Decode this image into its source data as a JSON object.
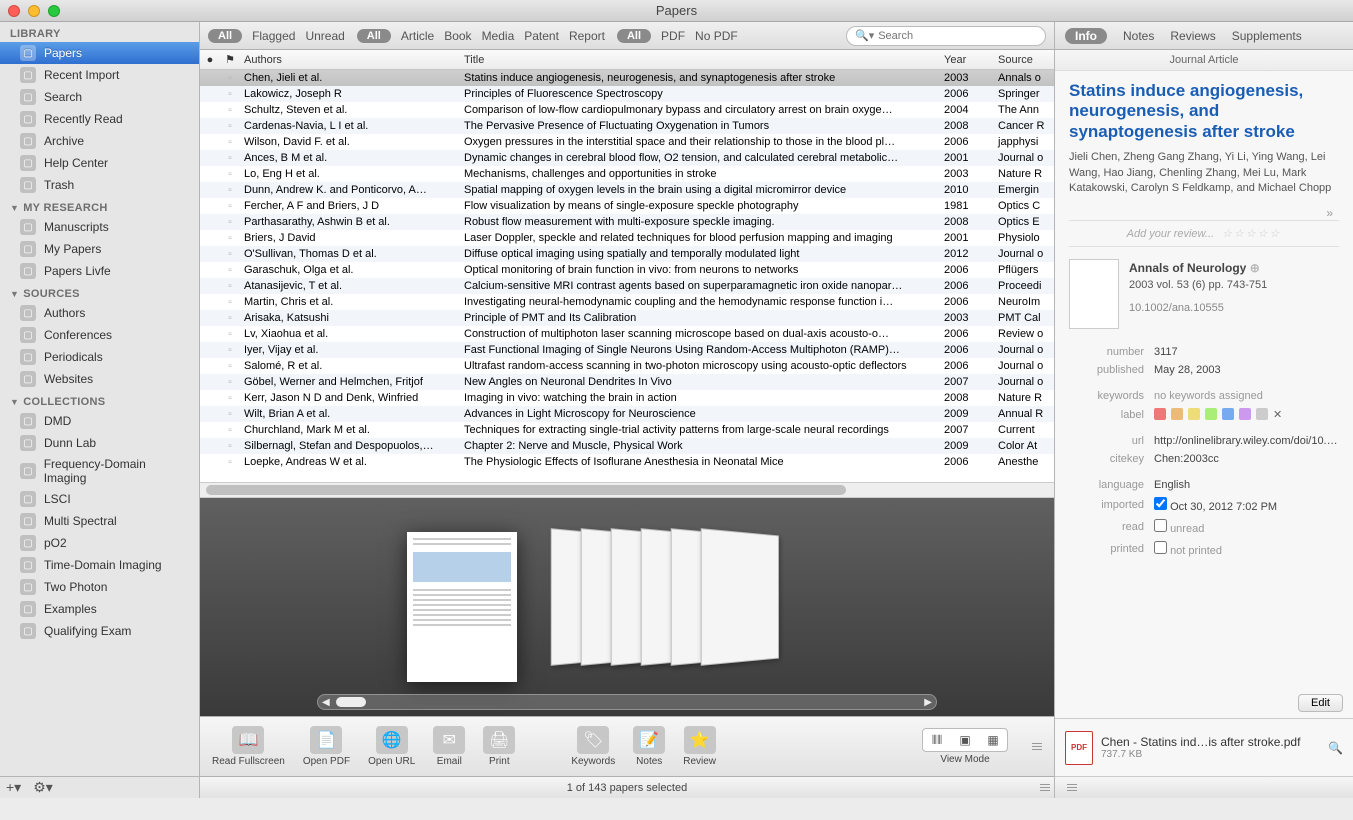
{
  "window": {
    "title": "Papers"
  },
  "sidebar": {
    "sections": [
      {
        "title": "LIBRARY",
        "items": [
          {
            "label": "Papers",
            "selected": true
          },
          {
            "label": "Recent Import"
          },
          {
            "label": "Search"
          },
          {
            "label": "Recently Read"
          },
          {
            "label": "Archive"
          },
          {
            "label": "Help Center"
          },
          {
            "label": "Trash"
          }
        ]
      },
      {
        "title": "MY RESEARCH",
        "items": [
          {
            "label": "Manuscripts"
          },
          {
            "label": "My Papers"
          },
          {
            "label": "Papers Livfe"
          }
        ]
      },
      {
        "title": "SOURCES",
        "items": [
          {
            "label": "Authors"
          },
          {
            "label": "Conferences"
          },
          {
            "label": "Periodicals"
          },
          {
            "label": "Websites"
          }
        ]
      },
      {
        "title": "COLLECTIONS",
        "items": [
          {
            "label": "DMD"
          },
          {
            "label": "Dunn Lab"
          },
          {
            "label": "Frequency-Domain Imaging"
          },
          {
            "label": "LSCI"
          },
          {
            "label": "Multi Spectral"
          },
          {
            "label": "pO2"
          },
          {
            "label": "Time-Domain Imaging"
          },
          {
            "label": "Two Photon"
          },
          {
            "label": "Examples"
          },
          {
            "label": "Qualifying Exam"
          }
        ]
      }
    ]
  },
  "toolbar": {
    "all1": "All",
    "flagged": "Flagged",
    "unread": "Unread",
    "all2": "All",
    "article": "Article",
    "book": "Book",
    "media": "Media",
    "patent": "Patent",
    "report": "Report",
    "all3": "All",
    "pdf": "PDF",
    "nopdf": "No PDF",
    "search_placeholder": "Search"
  },
  "columns": {
    "authors": "Authors",
    "title": "Title",
    "year": "Year",
    "source": "Source"
  },
  "papers": [
    {
      "authors": "Chen, Jieli et al.",
      "title": "Statins induce angiogenesis, neurogenesis, and synaptogenesis after stroke",
      "year": "2003",
      "source": "Annals o",
      "selected": true
    },
    {
      "authors": "Lakowicz, Joseph R",
      "title": "Principles of Fluorescence Spectroscopy",
      "year": "2006",
      "source": "Springer"
    },
    {
      "authors": "Schultz, Steven et al.",
      "title": "Comparison of low-flow cardiopulmonary bypass and circulatory arrest on brain oxyge…",
      "year": "2004",
      "source": "The Ann"
    },
    {
      "authors": "Cardenas-Navia, L I et al.",
      "title": "The Pervasive Presence of Fluctuating Oxygenation in Tumors",
      "year": "2008",
      "source": "Cancer R"
    },
    {
      "authors": "Wilson, David F. et al.",
      "title": "Oxygen pressures in the interstitial space and their relationship to those in the blood pl…",
      "year": "2006",
      "source": "japphysi"
    },
    {
      "authors": "Ances, B M et al.",
      "title": "Dynamic changes in cerebral blood flow, O2 tension, and calculated cerebral metabolic…",
      "year": "2001",
      "source": "Journal o"
    },
    {
      "authors": "Lo, Eng H et al.",
      "title": "Mechanisms, challenges and opportunities in stroke",
      "year": "2003",
      "source": "Nature R"
    },
    {
      "authors": "Dunn, Andrew K. and Ponticorvo, A…",
      "title": "Spatial mapping of oxygen levels in the brain using a digital micromirror device",
      "year": "2010",
      "source": "Emergin"
    },
    {
      "authors": "Fercher, A F and Briers, J D",
      "title": "Flow visualization by means of single-exposure speckle photography",
      "year": "1981",
      "source": "Optics C"
    },
    {
      "authors": "Parthasarathy, Ashwin B et al.",
      "title": "Robust flow measurement with multi-exposure speckle imaging.",
      "year": "2008",
      "source": "Optics E"
    },
    {
      "authors": "Briers, J David",
      "title": "Laser Doppler, speckle and related techniques for blood perfusion mapping and imaging",
      "year": "2001",
      "source": "Physiolo"
    },
    {
      "authors": "O'Sullivan, Thomas D et al.",
      "title": "Diffuse optical imaging using spatially and temporally modulated light",
      "year": "2012",
      "source": "Journal o"
    },
    {
      "authors": "Garaschuk, Olga et al.",
      "title": "Optical monitoring of brain function in vivo: from neurons to networks",
      "year": "2006",
      "source": "Pflügers"
    },
    {
      "authors": "Atanasijevic, T et al.",
      "title": "Calcium-sensitive MRI contrast agents based on superparamagnetic iron oxide nanopar…",
      "year": "2006",
      "source": "Proceedi"
    },
    {
      "authors": "Martin, Chris et al.",
      "title": "Investigating neural-hemodynamic coupling and the hemodynamic response function i…",
      "year": "2006",
      "source": "NeuroIm"
    },
    {
      "authors": "Arisaka, Katsushi",
      "title": "Principle of PMT and Its Calibration",
      "year": "2003",
      "source": "PMT Cal"
    },
    {
      "authors": "Lv, Xiaohua et al.",
      "title": "Construction of multiphoton laser scanning microscope based on dual-axis acousto-o…",
      "year": "2006",
      "source": "Review o"
    },
    {
      "authors": "Iyer, Vijay et al.",
      "title": "Fast Functional Imaging of Single Neurons Using Random-Access Multiphoton (RAMP)…",
      "year": "2006",
      "source": "Journal o"
    },
    {
      "authors": "Salomé, R et al.",
      "title": "Ultrafast random-access scanning in two-photon microscopy using acousto-optic deflectors",
      "year": "2006",
      "source": "Journal o"
    },
    {
      "authors": "Göbel, Werner and Helmchen, Fritjof",
      "title": "New Angles on Neuronal Dendrites In Vivo",
      "year": "2007",
      "source": "Journal o"
    },
    {
      "authors": "Kerr, Jason N D and Denk, Winfried",
      "title": "Imaging in vivo: watching the brain in action",
      "year": "2008",
      "source": "Nature R"
    },
    {
      "authors": "Wilt, Brian A et al.",
      "title": "Advances in Light Microscopy for Neuroscience",
      "year": "2009",
      "source": "Annual R"
    },
    {
      "authors": "Churchland, Mark M et al.",
      "title": "Techniques for extracting single-trial activity patterns from large-scale neural recordings",
      "year": "2007",
      "source": "Current"
    },
    {
      "authors": "Silbernagl, Stefan and Despopuolos,…",
      "title": "Chapter 2: Nerve and Muscle, Physical Work",
      "year": "2009",
      "source": "Color At"
    },
    {
      "authors": "Loepke, Andreas W et al.",
      "title": "The Physiologic Effects of Isoflurane Anesthesia in Neonatal Mice",
      "year": "2006",
      "source": "Anesthe"
    }
  ],
  "bottombar": {
    "items": [
      {
        "label": "Read Fullscreen"
      },
      {
        "label": "Open PDF"
      },
      {
        "label": "Open URL"
      },
      {
        "label": "Email"
      },
      {
        "label": "Print"
      },
      {
        "label": "Keywords"
      },
      {
        "label": "Notes"
      },
      {
        "label": "Review"
      }
    ],
    "viewmode": "View Mode"
  },
  "status": "1 of 143 papers selected",
  "inspector": {
    "tabs": {
      "info": "Info",
      "notes": "Notes",
      "reviews": "Reviews",
      "supplements": "Supplements"
    },
    "type": "Journal Article",
    "title": "Statins induce angiogenesis, neurogenesis, and synaptogenesis after stroke",
    "authors": "Jieli Chen, Zheng Gang Zhang, Yi Li, Ying Wang, Lei Wang, Hao Jiang, Chenling Zhang, Mei Lu, Mark Katakowski, Carolyn S Feldkamp, and Michael Chopp",
    "review_prompt": "Add your review...",
    "journal": {
      "name": "Annals of Neurology",
      "volume": "2003 vol. 53 (6) pp. 743-751",
      "doi": "10.1002/ana.10555"
    },
    "meta": {
      "number": "3117",
      "published": "May 28, 2003",
      "keywords": "no keywords assigned",
      "url": "http://onlinelibrary.wiley.com/doi/10.…",
      "citekey": "Chen:2003cc",
      "language": "English",
      "imported": "Oct 30, 2012 7:02 PM",
      "read": "unread",
      "printed": "not printed"
    },
    "labels": {
      "number": "number",
      "published": "published",
      "keywords": "keywords",
      "label": "label",
      "url": "url",
      "citekey": "citekey",
      "language": "language",
      "imported": "imported",
      "read": "read",
      "printed": "printed"
    },
    "edit": "Edit",
    "file": {
      "name": "Chen - Statins ind…is after stroke.pdf",
      "size": "737.7 KB"
    }
  }
}
